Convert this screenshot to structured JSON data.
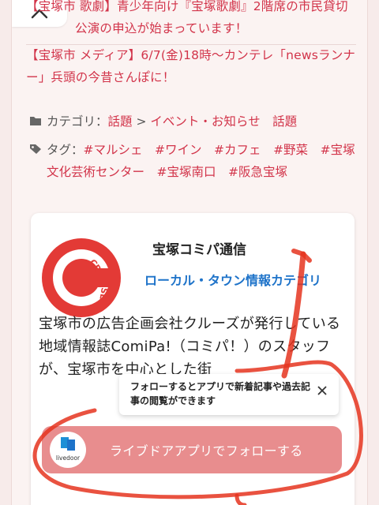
{
  "news": [
    {
      "text": "【宝塚市 歌劇】青少年向け『宝塚歌劇』2階席の市民貸切公演の申込が始まっています！"
    },
    {
      "text": "【宝塚市 メディア】6/7(金)18時〜カンテレ「newsランナー」兵頭の今昔さんぽに！"
    }
  ],
  "category": {
    "label": "カテゴリ：",
    "path_1": "話題",
    "sep": " > ",
    "path_2": "イベント・お知らせ",
    "path_3": "話題"
  },
  "tags": {
    "label": "タグ：",
    "items": [
      "#マルシェ",
      "#ワイン",
      "#カフェ",
      "#野菜",
      "#宝塚文化芸術センター",
      "#宝塚南口",
      "#阪急宝塚"
    ]
  },
  "profile": {
    "name": "宝塚コミパ通信",
    "category": "ローカル・タウン情報カテゴリ",
    "logo_text": "CRUISE",
    "description": "宝塚市の広告企画会社クルーズが発行している地域情報誌ComiPa!（コミパ！）のスタッフが、宝塚市を中心とした街"
  },
  "tooltip": {
    "text": "フォローするとアプリで新着記事や過去記事の閲覧ができます"
  },
  "follow": {
    "label": "ライブドアアプリでフォローする",
    "icon_text": "livedoor"
  },
  "colors": {
    "accent": "#d2344a",
    "link_blue": "#1e73c9",
    "follow_bg": "#e88d8e",
    "annotation_red": "#e5341f"
  }
}
